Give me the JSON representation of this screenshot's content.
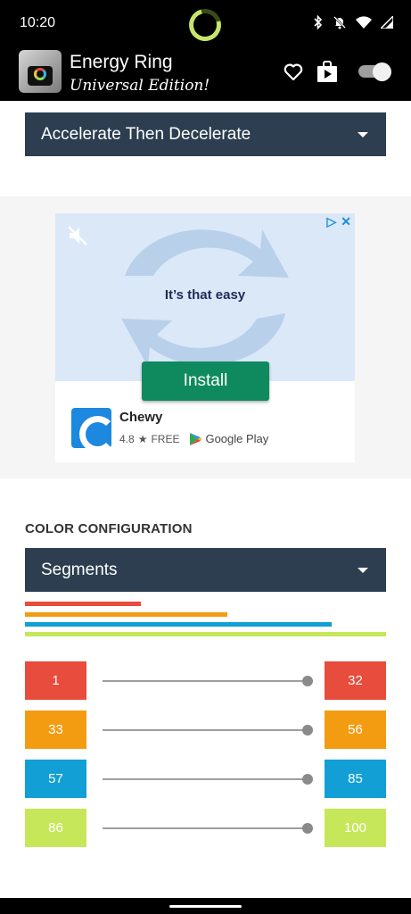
{
  "status_bar": {
    "time": "10:20",
    "icons": [
      "bluetooth-icon",
      "notifications-off-icon",
      "wifi-icon",
      "signal-icon"
    ]
  },
  "app_bar": {
    "title": "Energy Ring",
    "subtitle": "Universal Edition!",
    "icons": [
      "heart-icon",
      "store-icon"
    ],
    "toggle_on": true
  },
  "animation_dropdown": {
    "selected": "Accelerate Then Decelerate"
  },
  "ad": {
    "headline": "It’s that easy",
    "cta": "Install",
    "advertiser": "Chewy",
    "rating": "4.8",
    "price": "FREE",
    "store": "Google Play"
  },
  "color_configuration": {
    "heading": "COLOR CONFIGURATION",
    "mode_dropdown": {
      "selected": "Segments"
    },
    "segments": [
      {
        "start": "1",
        "end": "32",
        "color": "#e74c3c"
      },
      {
        "start": "33",
        "end": "56",
        "color": "#f39c12"
      },
      {
        "start": "57",
        "end": "85",
        "color": "#119fd5"
      },
      {
        "start": "86",
        "end": "100",
        "color": "#c6e75a"
      }
    ]
  },
  "colors": {
    "dropdown_bg": "#2c3e50",
    "install_green": "#0f8a5f",
    "ring_green": "#c7e46b"
  }
}
